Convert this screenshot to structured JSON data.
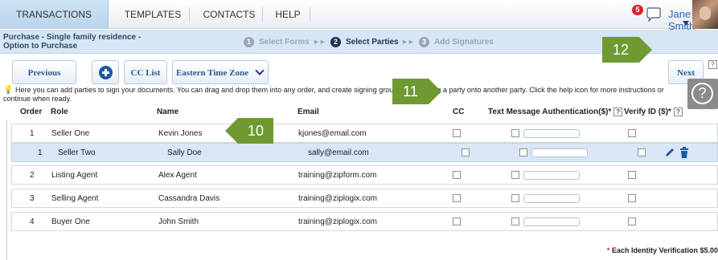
{
  "nav": {
    "tabs": [
      "TRANSACTIONS",
      "TEMPLATES",
      "CONTACTS",
      "HELP"
    ],
    "notification_count": "5",
    "user_name": "Jane Smith"
  },
  "breadcrumb": {
    "document_title": "Purchase - Single family residence - Option to Purchase",
    "steps": [
      {
        "num": "1",
        "label": "Select Forms"
      },
      {
        "num": "2",
        "label": "Select Parties"
      },
      {
        "num": "3",
        "label": "Add Signatures"
      }
    ],
    "arrow": "►►"
  },
  "toolbar": {
    "previous_label": "Previous",
    "cc_list_label": "CC List",
    "timezone_label": "Eastern Time Zone",
    "next_label": "Next"
  },
  "instructions": "Here you can add parties to sign your documents. You can drag and drop them into any order, and create signing groups by dropping a party onto another party. Click the help icon for more instructions or continue when ready.",
  "help_glyph": "?",
  "table": {
    "headers": {
      "order": "Order",
      "role": "Role",
      "name": "Name",
      "email": "Email",
      "cc": "CC",
      "text_auth": "Text Message Authentication($)*",
      "verify_id": "Verify ID ($)*"
    },
    "rows": [
      {
        "order": "1",
        "role": "Seller One",
        "name": "Kevin Jones",
        "email": "kjones@email.com"
      },
      {
        "order": "1",
        "role": "Seller Two",
        "name": "Sally Doe",
        "email": "sally@email.com"
      },
      {
        "order": "2",
        "role": "Listing Agent",
        "name": "Alex Agent",
        "email": "training@zipform.com"
      },
      {
        "order": "3",
        "role": "Selling Agent",
        "name": "Cassandra Davis",
        "email": "training@ziplogix.com"
      },
      {
        "order": "4",
        "role": "Buyer One",
        "name": "John Smith",
        "email": "training@ziplogix.com"
      }
    ]
  },
  "footnote": {
    "star": "*",
    "text": "Each Identity Verification $5.00"
  },
  "callouts": {
    "c10": "10",
    "c11": "11",
    "c12": "12"
  },
  "colors": {
    "accent": "#2b5a94",
    "step_current": "#1c3558",
    "callout_green": "#6f9a33",
    "badge_red": "#d9252b",
    "subrow_bg": "#d8e6f5"
  }
}
